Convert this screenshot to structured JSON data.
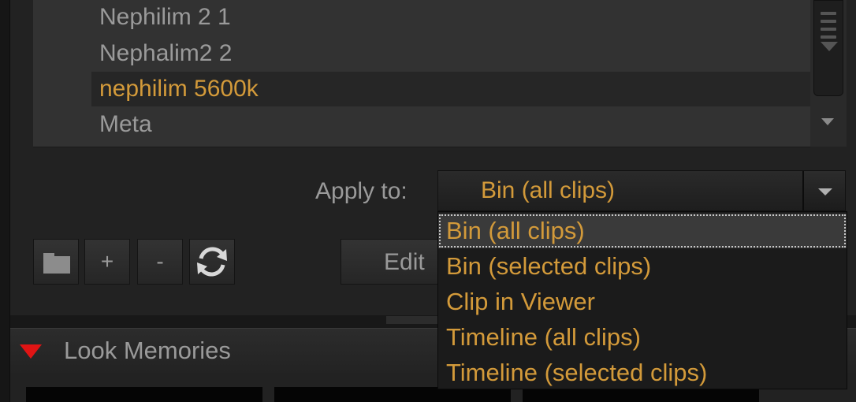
{
  "presets": {
    "items": [
      {
        "label": "Nephilim 2 1",
        "selected": false
      },
      {
        "label": "Nephalim2 2",
        "selected": false
      },
      {
        "label": "nephilim 5600k",
        "selected": true
      },
      {
        "label": "Meta",
        "selected": false
      }
    ]
  },
  "apply_to": {
    "label": "Apply to:",
    "value": "Bin (all clips)",
    "options": [
      "Bin (all clips)",
      "Bin (selected clips)",
      "Clip in Viewer",
      "Timeline (all clips)",
      "Timeline (selected clips)"
    ],
    "highlighted_index": 0
  },
  "toolbar": {
    "add_label": "+",
    "remove_label": "-",
    "edit_label": "Edit"
  },
  "look_memories": {
    "title": "Look Memories",
    "expanded": true
  },
  "colors": {
    "accent": "#d39a3a",
    "text": "#9a9a9a",
    "collapse_triangle": "#e01414"
  }
}
